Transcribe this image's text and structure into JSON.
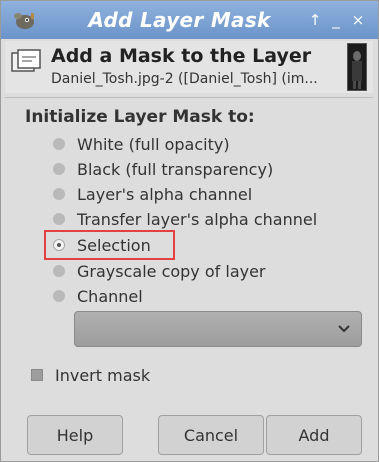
{
  "window": {
    "title": "Add Layer Mask",
    "buttons": {
      "restore": "↑",
      "minimize": "_",
      "close": "×"
    }
  },
  "header": {
    "title": "Add a Mask to the Layer",
    "subtitle": "Daniel_Tosh.jpg-2 ([Daniel_Tosh] (im..."
  },
  "init": {
    "label": "Initialize Layer Mask to:",
    "options": [
      {
        "label": "White (full opacity)",
        "checked": false
      },
      {
        "label": "Black (full transparency)",
        "checked": false
      },
      {
        "label": "Layer's alpha channel",
        "checked": false
      },
      {
        "label": "Transfer layer's alpha channel",
        "checked": false
      },
      {
        "label": "Selection",
        "checked": true
      },
      {
        "label": "Grayscale copy of layer",
        "checked": false
      },
      {
        "label": "Channel",
        "checked": false
      }
    ]
  },
  "channel_select": {
    "value": ""
  },
  "invert": {
    "label": "Invert mask",
    "checked": false
  },
  "footer": {
    "help": "Help",
    "cancel": "Cancel",
    "add": "Add"
  },
  "icons": {
    "app": "gimp-wilber-icon",
    "header": "layer-mask-icon",
    "dropdown": "chevron-down-icon"
  },
  "colors": {
    "highlight": "#e3413f",
    "titlebar": "#7aa0d3"
  }
}
